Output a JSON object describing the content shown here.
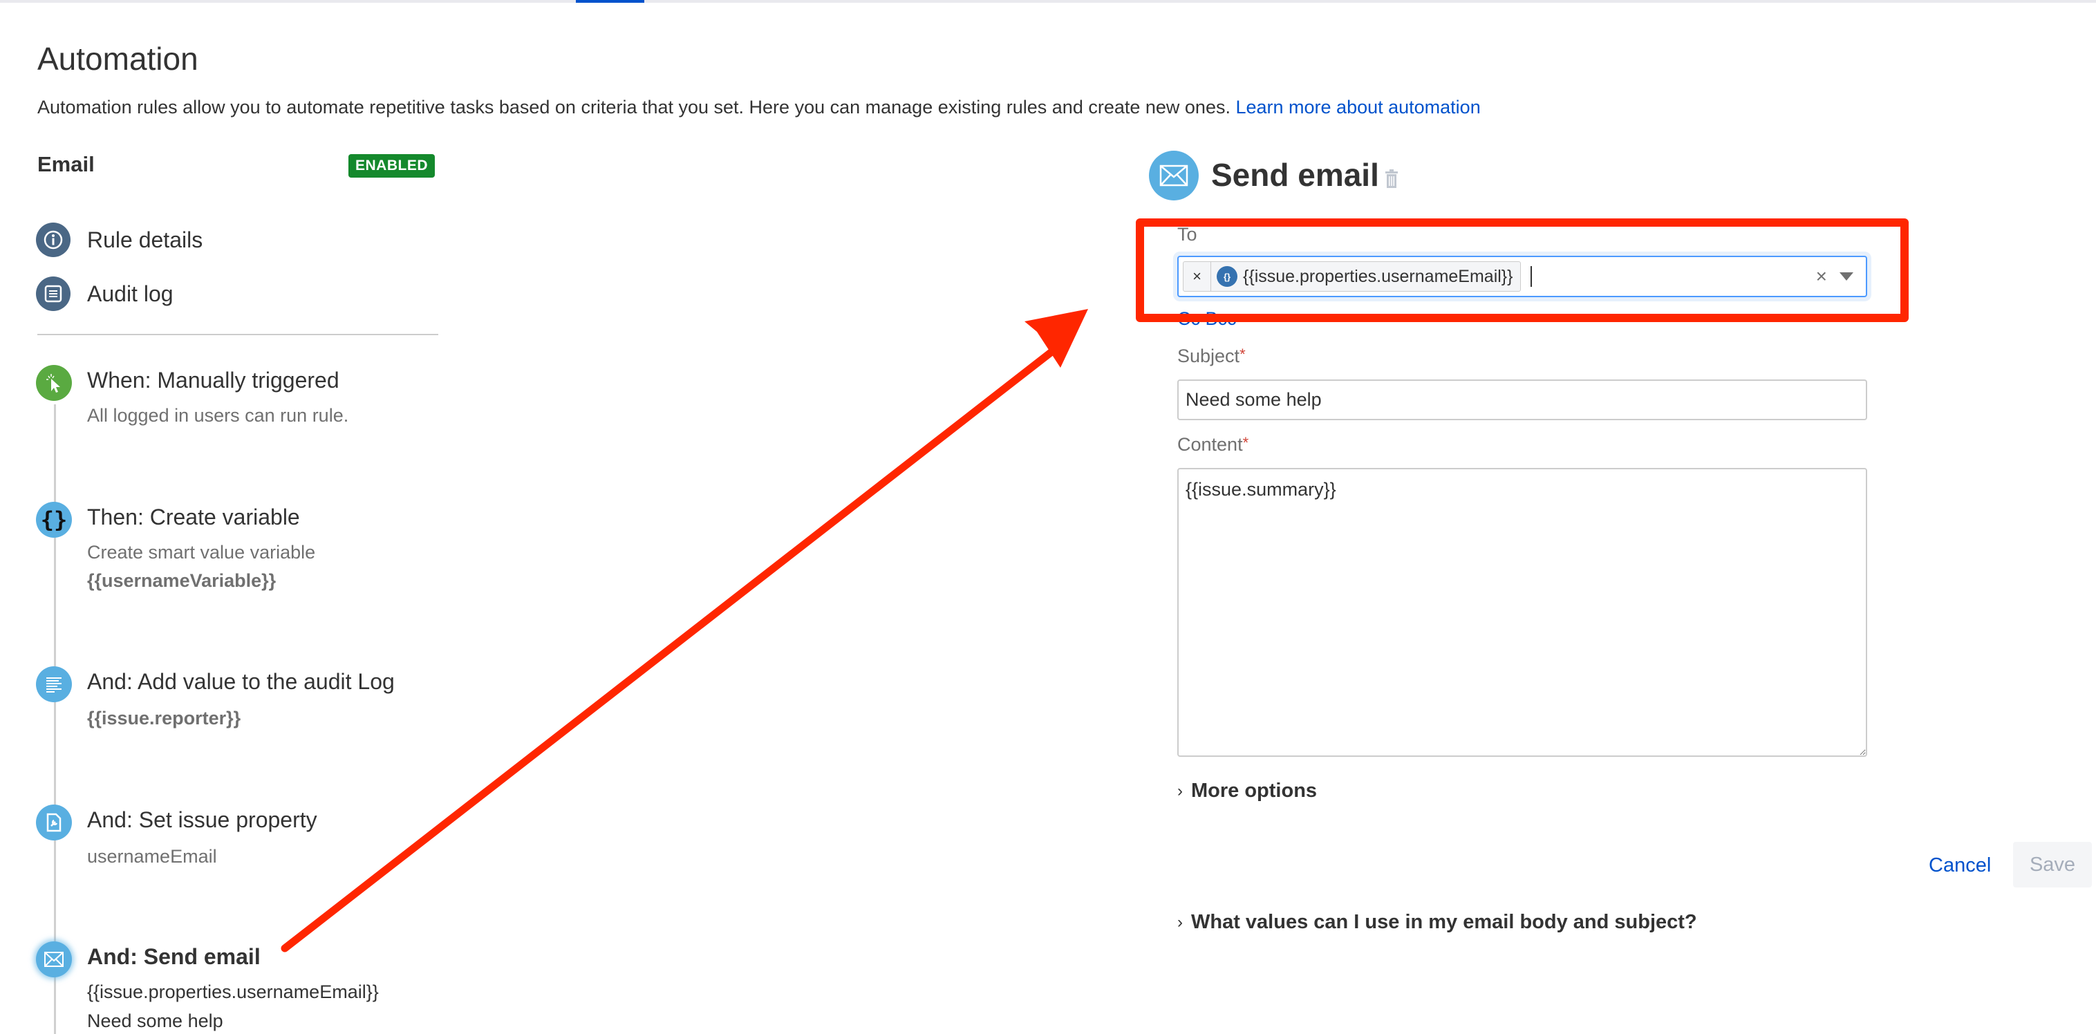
{
  "page": {
    "title": "Automation",
    "description": "Automation rules allow you to automate repetitive tasks based on criteria that you set. Here you can manage existing rules and create new ones.",
    "learn_more_link": "Learn more about automation",
    "accent_color": "#0052cc"
  },
  "rule": {
    "name": "Email",
    "status": "ENABLED",
    "status_color": "#14892c"
  },
  "nav": {
    "items": [
      {
        "label": "Rule details",
        "icon": "info-icon"
      },
      {
        "label": "Audit log",
        "icon": "list-icon"
      }
    ]
  },
  "steps": [
    {
      "title": "When: Manually triggered",
      "lines": [
        "All logged in users can run rule."
      ],
      "icon": "cursor-click-icon"
    },
    {
      "title": "Then: Create variable",
      "lines": [
        "Create smart value variable",
        "{{usernameVariable}}"
      ],
      "icon": "braces-icon"
    },
    {
      "title": "And: Add value to the audit Log",
      "lines": [
        "{{issue.reporter}}"
      ],
      "icon": "audit-log-icon"
    },
    {
      "title": "And: Set issue property",
      "lines": [
        "usernameEmail"
      ],
      "icon": "issue-property-icon"
    },
    {
      "title": "And: Send email",
      "lines": [
        "{{issue.properties.usernameEmail}}",
        "Need some help"
      ],
      "icon": "envelope-icon",
      "selected": true
    }
  ],
  "panel": {
    "title": "Send email",
    "to": {
      "label": "To",
      "chips": [
        {
          "text": "{{issue.properties.usernameEmail}}",
          "remove_label": "×"
        }
      ],
      "clear_label": "×"
    },
    "cc_bcc_label": "Cc Bcc",
    "subject": {
      "label": "Subject",
      "required_mark": "*",
      "value": "Need some help"
    },
    "content": {
      "label": "Content",
      "required_mark": "*",
      "value": "{{issue.summary}}"
    },
    "more_options_label": "More options",
    "cancel_label": "Cancel",
    "save_label": "Save",
    "help_label": "What values can I use in my email body and subject?"
  },
  "annotation": {
    "color": "#ff2600"
  }
}
